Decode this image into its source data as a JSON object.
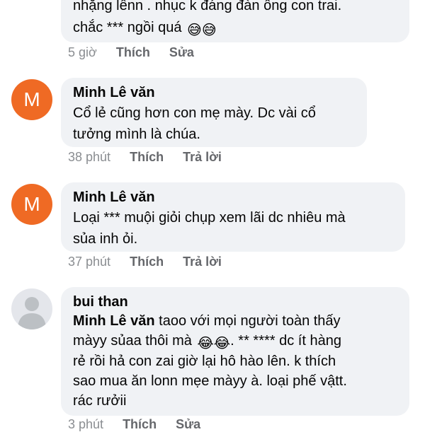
{
  "colors": {
    "bubble": "#f0f2f5",
    "avatar_orange": "#ef6a24",
    "meta_gray": "#65676b"
  },
  "comments": [
    {
      "text_lines": [
        "nhặng lênn . nhục k đáng đàn ông con trai.",
        "chắc *** ngồi quá"
      ],
      "emoji": "😅😅",
      "time": "5 giờ",
      "like_label": "Thích",
      "second_action": "Sửa"
    },
    {
      "avatar_letter": "M",
      "author": "Minh Lê văn",
      "text_lines": [
        "Cổ lẻ cũng hơn con mẹ mày. Dc vài cổ",
        "tưởng mình là chúa."
      ],
      "time": "38 phút",
      "like_label": "Thích",
      "second_action": "Trả lời"
    },
    {
      "avatar_letter": "M",
      "author": "Minh Lê văn",
      "text_lines": [
        "Loại *** muội giỏi chụp xem lãi dc nhiêu mà",
        "sủa inh ỏi."
      ],
      "time": "37 phút",
      "like_label": "Thích",
      "second_action": "Trả lời"
    },
    {
      "author": "bui than",
      "mention": "Minh Lê văn",
      "line1_rest": "  taoo với mọi người toàn thấy",
      "line2": "mày​y sủaa thôi mà",
      "emoji": "😂😂",
      "line2_rest": ". ** **** dc ít hàng",
      "text_lines": [
        "rẻ rồi hả con zai giờ lại hô hào lên. k thích",
        "sao mua ăn lonn mẹe mày​y à. loại phế vậtt.",
        "rác rưởii"
      ],
      "time": "3 phút",
      "like_label": "Thích",
      "second_action": "Sửa"
    }
  ]
}
